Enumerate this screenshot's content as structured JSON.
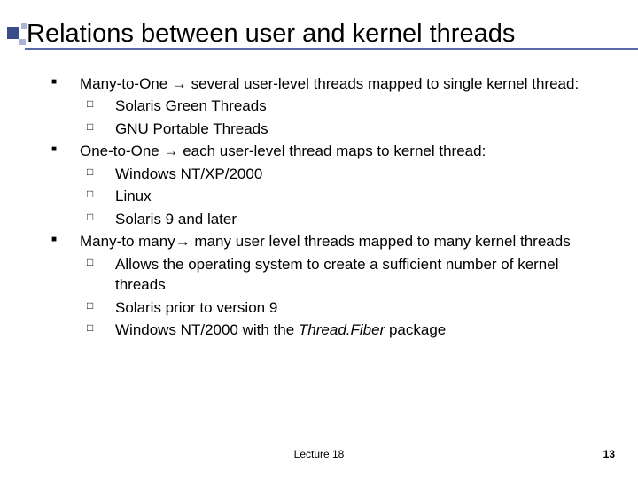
{
  "title": "Relations between user and kernel threads",
  "bullets": {
    "b1": {
      "text": "Many-to-One → several user-level threads mapped to single kernel thread:",
      "sub": [
        "Solaris Green Threads",
        "GNU Portable Threads"
      ]
    },
    "b2": {
      "text": "One-to-One  → each user-level thread maps to kernel thread:",
      "sub": [
        "Windows NT/XP/2000",
        "Linux",
        "Solaris 9 and later"
      ]
    },
    "b3": {
      "text": "Many-to many→ many user level threads mapped to many kernel threads",
      "sub": [
        "Allows the  operating system to create a sufficient number of kernel threads",
        "Solaris prior to version 9"
      ],
      "sub_last_prefix": "Windows NT/2000 with the ",
      "sub_last_italic": "Thread.Fiber",
      "sub_last_suffix": " package"
    }
  },
  "footer": "Lecture 18",
  "page_number": "13"
}
